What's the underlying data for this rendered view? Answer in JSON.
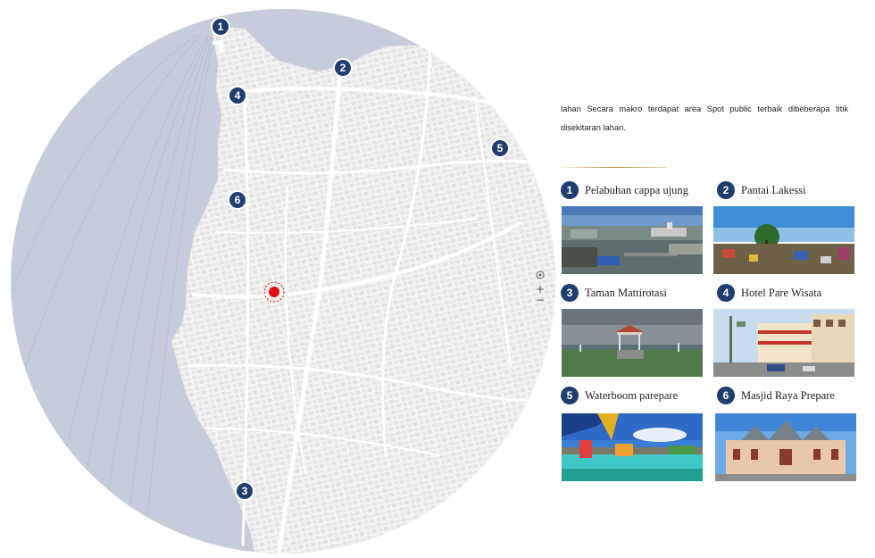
{
  "map": {
    "markers": [
      "1",
      "2",
      "3",
      "4",
      "5",
      "6"
    ],
    "zoom": {
      "locate_icon": "crosshair-icon",
      "in_label": "+",
      "out_label": "−"
    },
    "colors": {
      "sea": "#c7ccda",
      "land": "#f4f4f4",
      "marker": "#1f3e6e",
      "location": "#e01010"
    }
  },
  "description": "lahan Secara makro terdapat area Spot public terbaik dibeberapa titik disekitaran lahan.",
  "spots": [
    {
      "number": "1",
      "title": "Pelabuhan cappa ujung"
    },
    {
      "number": "2",
      "title": "Pantai Lakessi"
    },
    {
      "number": "3",
      "title": "Taman Mattirotasi"
    },
    {
      "number": "4",
      "title": "Hotel Pare Wisata"
    },
    {
      "number": "5",
      "title": "Waterboom parepare"
    },
    {
      "number": "6",
      "title": "Masjid Raya Prepare"
    }
  ]
}
